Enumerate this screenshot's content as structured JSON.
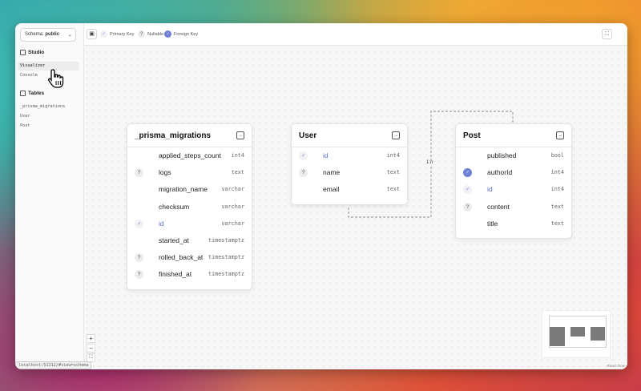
{
  "sidebar": {
    "schema_label": "Schema:",
    "schema_value": "public",
    "studio_title": "Studio",
    "studio_items": [
      "Visualizer",
      "Console"
    ],
    "tables_title": "Tables",
    "table_items": [
      "_prisma_migrations",
      "User",
      "Post"
    ]
  },
  "toolbar": {
    "legend": {
      "primary_key": "Primary Key",
      "nullable": "Nullable",
      "foreign_key": "Foreign Key"
    }
  },
  "tables": {
    "migrations": {
      "name": "_prisma_migrations",
      "fields": [
        {
          "badge": "",
          "name": "applied_steps_count",
          "type": "int4"
        },
        {
          "badge": "nullable",
          "name": "logs",
          "type": "text"
        },
        {
          "badge": "",
          "name": "migration_name",
          "type": "varchar"
        },
        {
          "badge": "",
          "name": "checksum",
          "type": "varchar"
        },
        {
          "badge": "pk",
          "name": "id",
          "type": "varchar"
        },
        {
          "badge": "",
          "name": "started_at",
          "type": "timestamptz"
        },
        {
          "badge": "nullable",
          "name": "rolled_back_at",
          "type": "timestamptz"
        },
        {
          "badge": "nullable",
          "name": "finished_at",
          "type": "timestamptz"
        }
      ]
    },
    "user": {
      "name": "User",
      "fields": [
        {
          "badge": "pk",
          "name": "id",
          "type": "int4"
        },
        {
          "badge": "nullable",
          "name": "name",
          "type": "text"
        },
        {
          "badge": "",
          "name": "email",
          "type": "text"
        }
      ]
    },
    "post": {
      "name": "Post",
      "fields": [
        {
          "badge": "",
          "name": "published",
          "type": "bool"
        },
        {
          "badge": "fk",
          "name": "authorId",
          "type": "int4"
        },
        {
          "badge": "pk",
          "name": "id",
          "type": "int4"
        },
        {
          "badge": "nullable",
          "name": "content",
          "type": "text"
        },
        {
          "badge": "",
          "name": "title",
          "type": "text"
        }
      ]
    }
  },
  "relation_label": "1:n",
  "zoom_controls": {
    "zoom_in": "+",
    "zoom_out": "−"
  },
  "status_url": "localhost:51212/#view=schema",
  "attribution": "React Flow",
  "colors": {
    "accent": "#6d7fd6",
    "key_text": "#5b6fcc"
  }
}
